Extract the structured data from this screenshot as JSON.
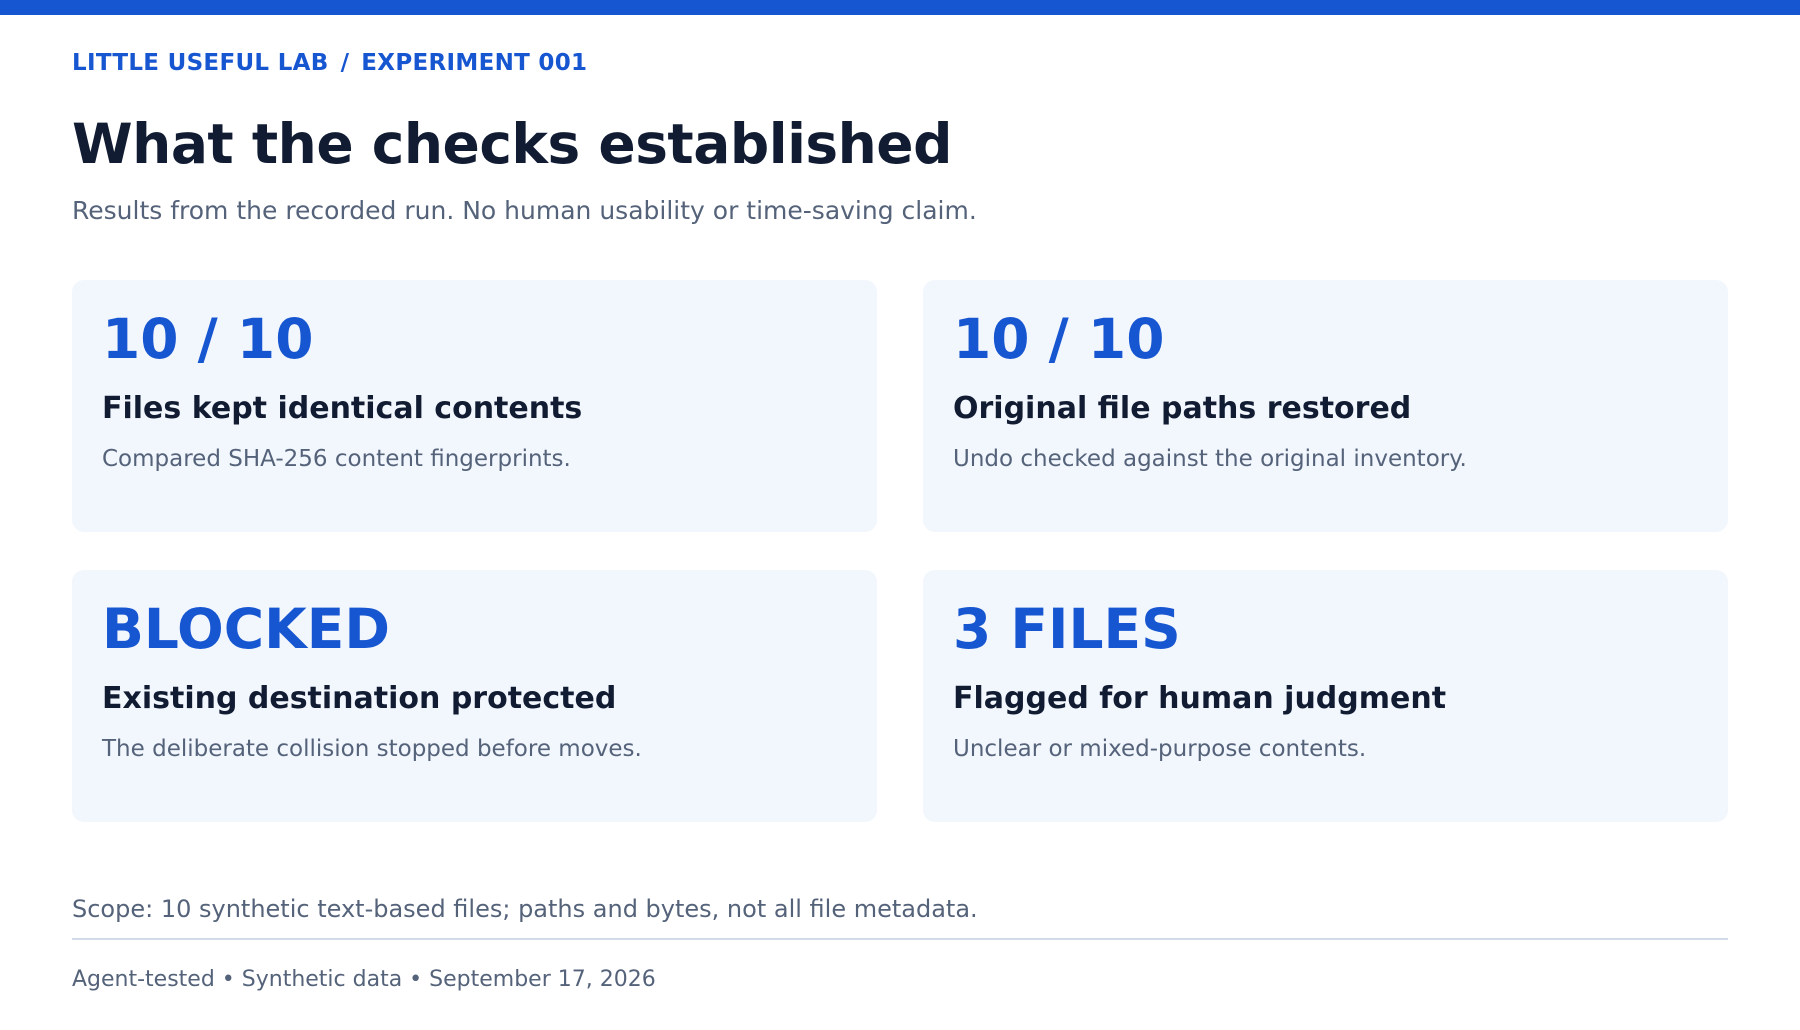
{
  "colors": {
    "accent": "#1756d1",
    "title": "#111c33",
    "muted": "#55637a",
    "card_bg": "#f2f6fd",
    "divider": "#d2dce8"
  },
  "breadcrumb": {
    "lab": "LITTLE USEFUL LAB",
    "separator": "/",
    "experiment": "EXPERIMENT 001"
  },
  "header": {
    "title": "What the checks established",
    "subtitle": "Results from the recorded run. No human usability or time-saving claim."
  },
  "cards": [
    {
      "metric": "10 / 10",
      "heading": "Files kept identical contents",
      "description": "Compared SHA-256 content fingerprints."
    },
    {
      "metric": "10 / 10",
      "heading": "Original file paths restored",
      "description": "Undo checked against the original inventory."
    },
    {
      "metric": "BLOCKED",
      "heading": "Existing destination protected",
      "description": "The deliberate collision stopped before moves."
    },
    {
      "metric": "3 FILES",
      "heading": "Flagged for human judgment",
      "description": "Unclear or mixed-purpose contents."
    }
  ],
  "scope": "Scope: 10 synthetic text-based files; paths and bytes, not all file metadata.",
  "footer": "Agent-tested • Synthetic data • September 17, 2026"
}
